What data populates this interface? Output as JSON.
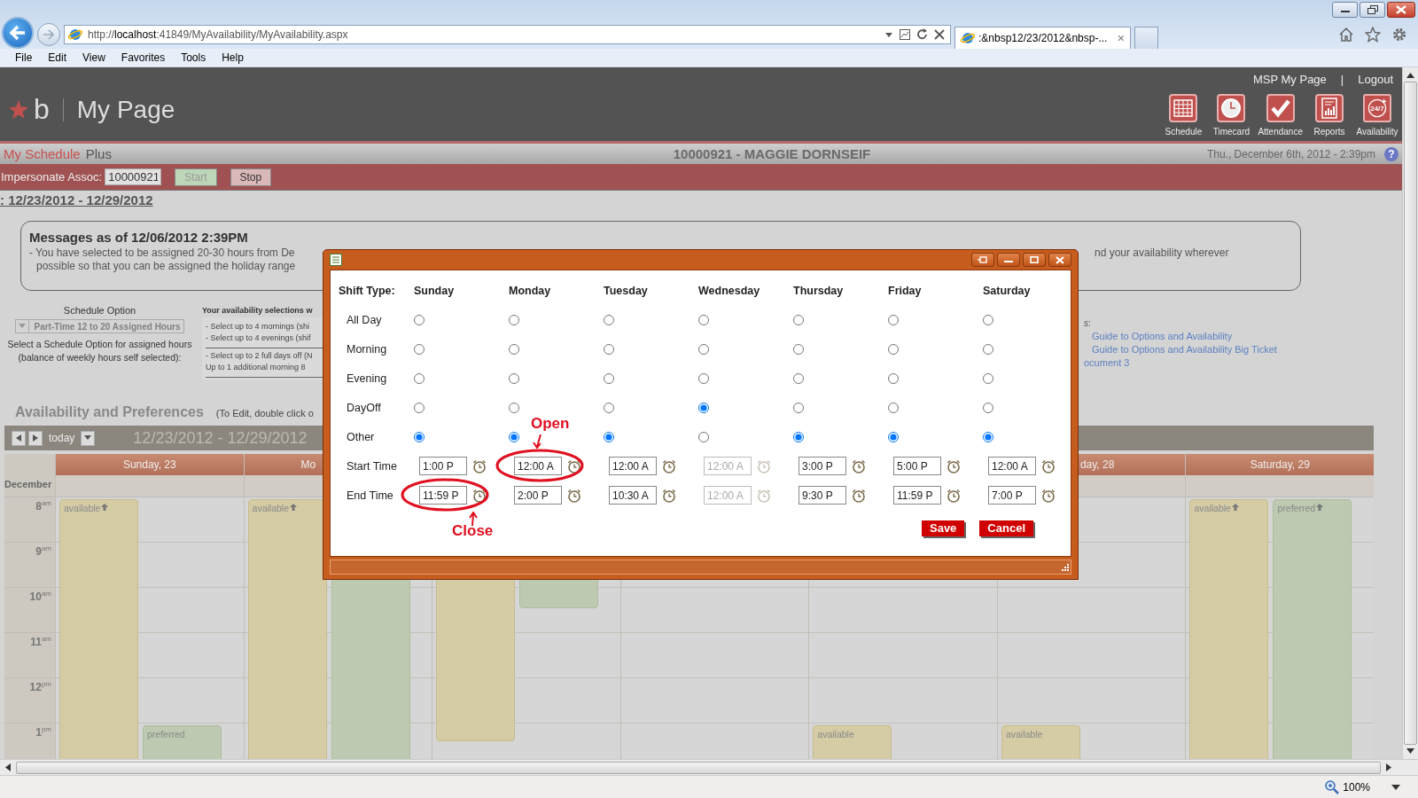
{
  "browser": {
    "address": "http://**localhost**:41849/MyAvailability/MyAvailability.aspx",
    "tab_title": ":&nbsp12/23/2012&nbsp-...",
    "tab_close": "×",
    "menu": [
      "File",
      "Edit",
      "View",
      "Favorites",
      "Tools",
      "Help"
    ],
    "zoom": "100%"
  },
  "header": {
    "logo_letter": "b",
    "title": "My Page",
    "links": [
      "MSP My Page",
      "|",
      "Logout"
    ],
    "nav": [
      {
        "label": "Schedule",
        "kind": "calendar"
      },
      {
        "label": "Timecard",
        "kind": "clock"
      },
      {
        "label": "Attendance",
        "kind": "check"
      },
      {
        "label": "Reports",
        "kind": "report"
      },
      {
        "label": "Availability",
        "kind": "badge",
        "badge": "24/7"
      }
    ]
  },
  "app_bar": {
    "product": "My Schedule",
    "edition": "Plus",
    "associate": "10000921 - MAGGIE DORNSEIF",
    "datetime": "Thu., December 6th, 2012 - 2:39pm",
    "help": "?"
  },
  "impersonate": {
    "label": "Impersonate Assoc:",
    "value": "10000921",
    "buttons": [
      {
        "label": "Start",
        "disabled": true
      },
      {
        "label": "Stop",
        "disabled": false
      }
    ]
  },
  "week_heading": ": 12/23/2012 - 12/29/2012",
  "messages": {
    "title": "Messages as of 12/06/2012 2:39PM",
    "line_1_left": "- You have selected to be assigned 20-30 hours from De",
    "line_1_right": "nd your availability wherever",
    "line_2": "possible so that you can be assigned the holiday range"
  },
  "schedule_option": {
    "title": "Schedule Option",
    "dropdown": "Part-Time 12 to 20 Assigned Hours",
    "hint": [
      "Select a Schedule Option for assigned hours",
      "(balance of weekly hours self selected):"
    ]
  },
  "selections": {
    "title": "Your availability selections w",
    "groups": [
      [
        "- Select up to 4 mornings (shi",
        "- Select up to 4 evenings (shif"
      ],
      [
        "- Select up to 2 full days off (N",
        "Up to 1 additional morning 8"
      ]
    ]
  },
  "documents": {
    "title": "s:",
    "links": [
      "Guide to Options and Availability",
      "Guide to Options and Availability Big Ticket",
      "ocument 3"
    ]
  },
  "calendar": {
    "title": "Availability and Preferences",
    "hint": "(To Edit, double click o",
    "today": "today",
    "range": "12/23/2012 - 12/29/2012",
    "month": "December",
    "hours": [
      "8$^{am}$",
      "9$^{am}$",
      "10$^{am}$",
      "11$^{am}$",
      "12$^{pm}$",
      "1$^{pm}$"
    ],
    "days": [
      {
        "kind": "day",
        "label": "Sunday, 23",
        "events": [
          {
            "kind": "available",
            "label": "available",
            "marker": true
          },
          {
            "kind": "preferred",
            "label": "preferred",
            "marker": false
          }
        ]
      },
      {
        "kind": "day",
        "label": "Mo",
        "events": [
          {
            "kind": "available",
            "label": "available",
            "marker": true
          },
          {
            "kind": "preferred"
          }
        ]
      },
      {
        "kind": "day",
        "events": [
          {
            "kind": "available"
          },
          {
            "kind": "preferred"
          }
        ]
      },
      {
        "kind": "day"
      },
      {
        "kind": "day",
        "events": [
          {
            "kind": "available",
            "label": "available",
            "marker": false
          }
        ]
      },
      {
        "kind": "day",
        "label": "day, 28",
        "events": [
          {
            "kind": "available",
            "label": "available",
            "marker": false
          }
        ]
      },
      {
        "kind": "day",
        "label": "Saturday, 29",
        "events": [
          {
            "kind": "available",
            "label": "available",
            "marker": true
          },
          {
            "kind": "preferred",
            "label": "preferred",
            "marker": true
          }
        ]
      }
    ]
  },
  "dialog": {
    "columns_label": "Shift Type:",
    "days": [
      "Sunday",
      "Monday",
      "Tuesday",
      "Wednesday",
      "Thursday",
      "Friday",
      "Saturday"
    ],
    "shift_rows": [
      {
        "label": "All Day",
        "options": [
          {
            "selected": false
          },
          {
            "selected": false
          },
          {
            "selected": false
          },
          {
            "selected": false
          },
          {
            "selected": false
          },
          {
            "selected": false
          },
          {
            "selected": false
          }
        ]
      },
      {
        "label": "Morning",
        "options": [
          {
            "selected": false
          },
          {
            "selected": false
          },
          {
            "selected": false
          },
          {
            "selected": false
          },
          {
            "selected": false
          },
          {
            "selected": false
          },
          {
            "selected": false
          }
        ]
      },
      {
        "label": "Evening",
        "options": [
          {
            "selected": false
          },
          {
            "selected": false
          },
          {
            "selected": false
          },
          {
            "selected": false
          },
          {
            "selected": false
          },
          {
            "selected": false
          },
          {
            "selected": false
          }
        ]
      },
      {
        "label": "DayOff",
        "options": [
          {
            "selected": false
          },
          {
            "selected": false
          },
          {
            "selected": false
          },
          {
            "selected": true
          },
          {
            "selected": false
          },
          {
            "selected": false
          },
          {
            "selected": false
          }
        ]
      },
      {
        "label": "Other",
        "options": [
          {
            "selected": true
          },
          {
            "selected": true
          },
          {
            "selected": true
          },
          {
            "selected": false
          },
          {
            "selected": true
          },
          {
            "selected": true
          },
          {
            "selected": true
          }
        ]
      }
    ],
    "time_rows": [
      {
        "label": "Start Time",
        "fields": [
          {
            "value": "1:00 P",
            "disabled": false
          },
          {
            "value": "12:00 A",
            "disabled": false,
            "annotation": {
              "label": "Open"
            }
          },
          {
            "value": "12:00 A",
            "disabled": false
          },
          {
            "value": "12:00 A",
            "disabled": true
          },
          {
            "value": "3:00 P",
            "disabled": false
          },
          {
            "value": "5:00 P",
            "disabled": false
          },
          {
            "value": "12:00 A",
            "disabled": false
          }
        ]
      },
      {
        "label": "End Time",
        "fields": [
          {
            "value": "11:59 P",
            "disabled": false,
            "annotation": {
              "label": "Close"
            }
          },
          {
            "value": "2:00 P",
            "disabled": false
          },
          {
            "value": "10:30 A",
            "disabled": false
          },
          {
            "value": "12:00 A",
            "disabled": true
          },
          {
            "value": "9:30 P",
            "disabled": false
          },
          {
            "value": "11:59 P",
            "disabled": false
          },
          {
            "value": "7:00 P",
            "disabled": false
          }
        ]
      }
    ],
    "buttons": [
      "Save",
      "Cancel"
    ]
  }
}
